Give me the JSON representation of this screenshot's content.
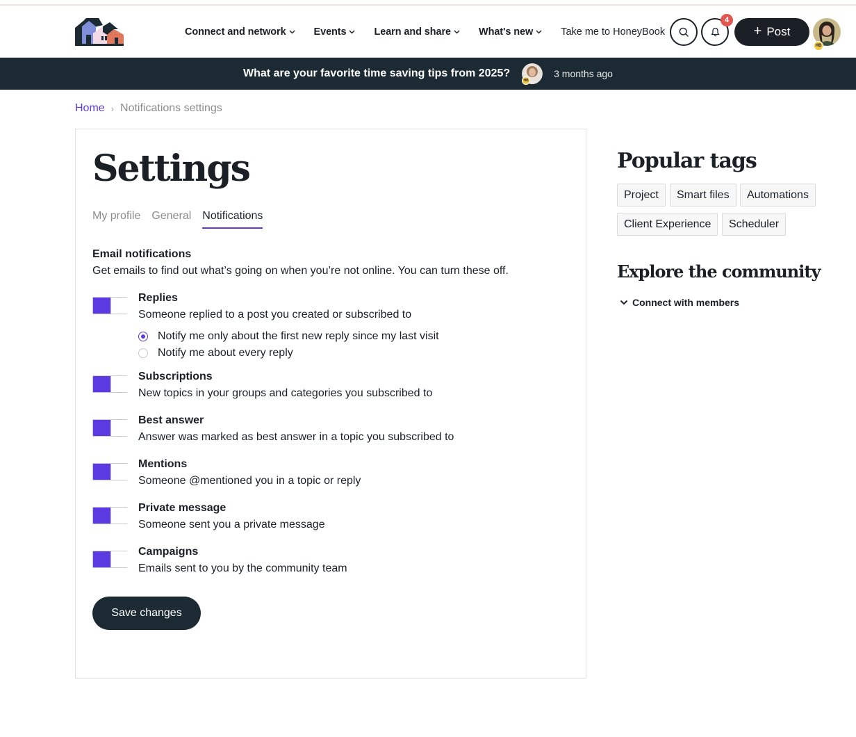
{
  "header": {
    "nav": [
      {
        "label": "Connect and network"
      },
      {
        "label": "Events"
      },
      {
        "label": "Learn and share"
      },
      {
        "label": "What's new"
      }
    ],
    "nav_link": "Take me to HoneyBook",
    "notification_count": "4",
    "post_label": "Post",
    "avatar_badge": "HB"
  },
  "announcement": {
    "title": "What are your favorite time saving tips from 2025?",
    "time": "3 months ago",
    "avatar_badge": "HB"
  },
  "breadcrumb": {
    "home": "Home",
    "separator": "›",
    "current": "Notifications settings"
  },
  "settings": {
    "title": "Settings",
    "tabs": [
      {
        "label": "My profile",
        "active": false
      },
      {
        "label": "General",
        "active": false
      },
      {
        "label": "Notifications",
        "active": true
      }
    ],
    "email_title": "Email notifications",
    "email_desc": "Get emails to find out what’s going on when you’re not online. You can turn these off.",
    "items": [
      {
        "title": "Replies",
        "desc": "Someone replied to a post you created or subscribed to",
        "enabled": true
      },
      {
        "title": "Subscriptions",
        "desc": "New topics in your groups and categories you subscribed to",
        "enabled": true
      },
      {
        "title": "Best answer",
        "desc": "Answer was marked as best answer in a topic you subscribed to",
        "enabled": true
      },
      {
        "title": "Mentions",
        "desc": "Someone @mentioned you in a topic or reply",
        "enabled": true
      },
      {
        "title": "Private message",
        "desc": "Someone sent you a private message",
        "enabled": true
      },
      {
        "title": "Campaigns",
        "desc": "Emails sent to you by the community team",
        "enabled": true
      }
    ],
    "reply_options": [
      {
        "label": "Notify me only about the first new reply since my last visit",
        "selected": true
      },
      {
        "label": "Notify me about every reply",
        "selected": false
      }
    ],
    "save_label": "Save changes"
  },
  "sidebar": {
    "popular_title": "Popular tags",
    "tags": [
      "Project",
      "Smart files",
      "Automations",
      "Client Experience",
      "Scheduler"
    ],
    "explore_title": "Explore the community",
    "explore_link": "Connect with members"
  },
  "colors": {
    "accent": "#5b3be1",
    "dark": "#1b2a33",
    "badge": "#e0584f"
  }
}
